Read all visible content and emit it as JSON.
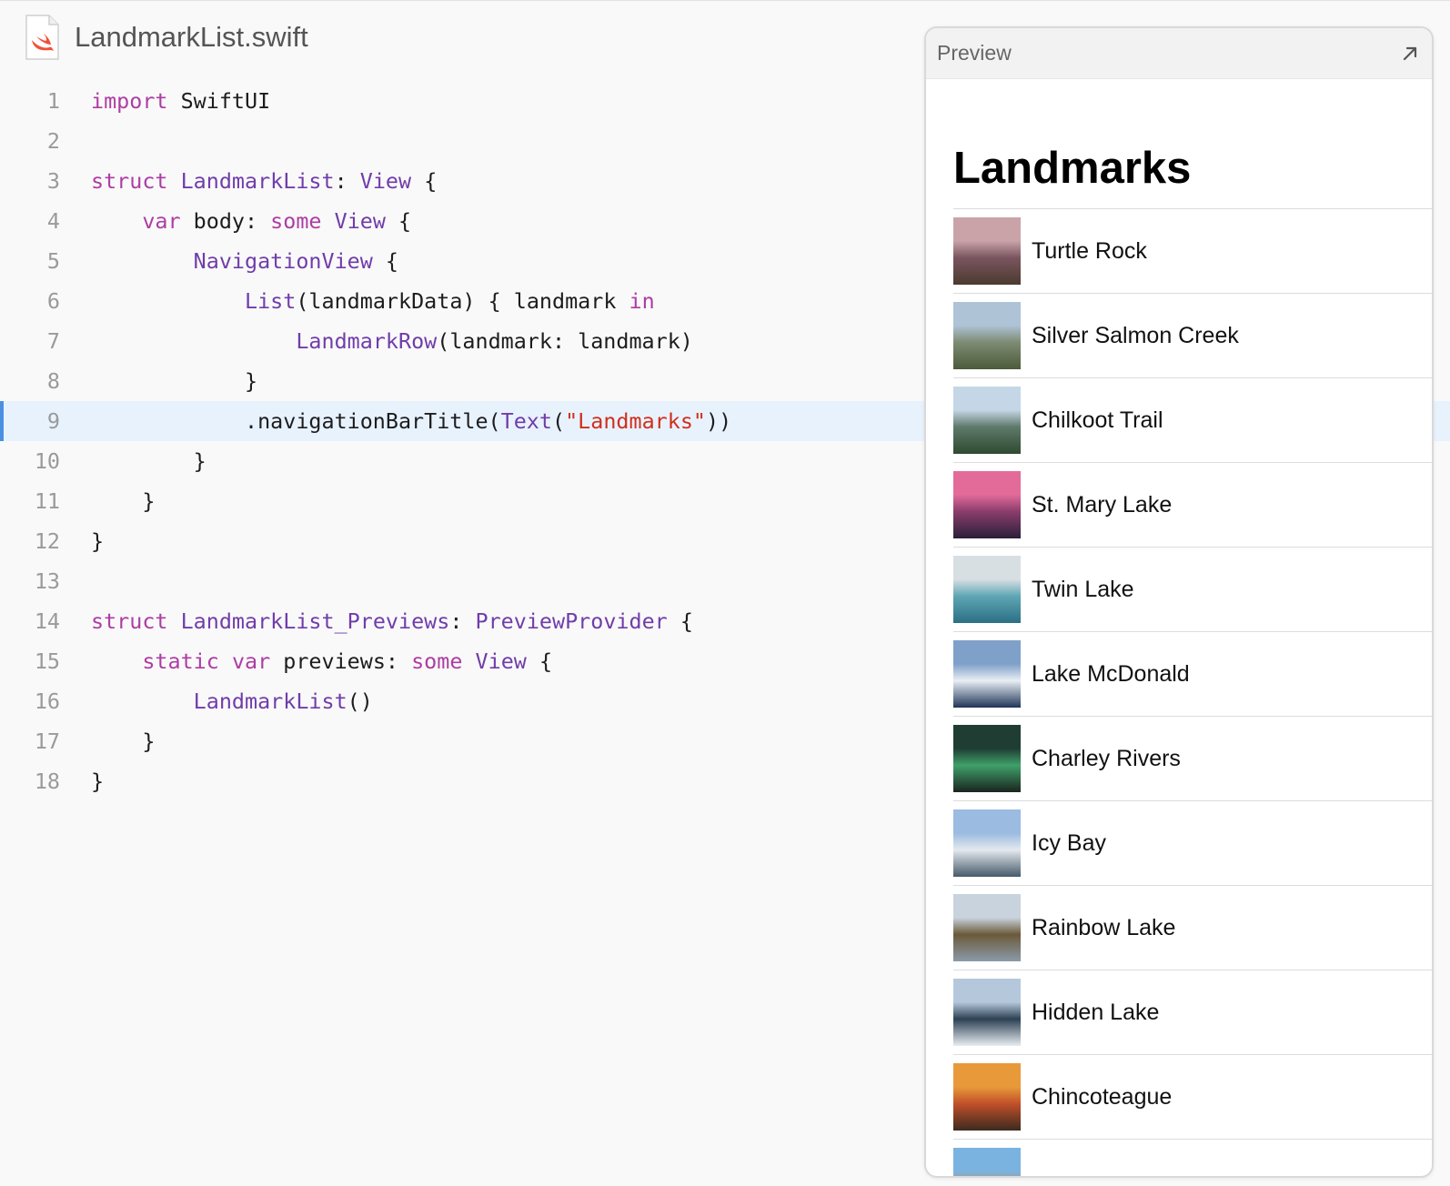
{
  "file": {
    "name": "LandmarkList.swift",
    "icon": "swift-file-icon"
  },
  "code_lines": [
    {
      "n": "1",
      "tokens": [
        [
          "kw",
          "import"
        ],
        [
          "pl",
          " SwiftUI"
        ]
      ]
    },
    {
      "n": "2",
      "tokens": []
    },
    {
      "n": "3",
      "tokens": [
        [
          "kw",
          "struct"
        ],
        [
          "pl",
          " "
        ],
        [
          "ty",
          "LandmarkList"
        ],
        [
          "pl",
          ": "
        ],
        [
          "ty",
          "View"
        ],
        [
          "pl",
          " {"
        ]
      ]
    },
    {
      "n": "4",
      "tokens": [
        [
          "pl",
          "    "
        ],
        [
          "kw",
          "var"
        ],
        [
          "pl",
          " body: "
        ],
        [
          "kw",
          "some"
        ],
        [
          "pl",
          " "
        ],
        [
          "ty",
          "View"
        ],
        [
          "pl",
          " {"
        ]
      ]
    },
    {
      "n": "5",
      "tokens": [
        [
          "pl",
          "        "
        ],
        [
          "ty",
          "NavigationView"
        ],
        [
          "pl",
          " {"
        ]
      ]
    },
    {
      "n": "6",
      "tokens": [
        [
          "pl",
          "            "
        ],
        [
          "ty",
          "List"
        ],
        [
          "pl",
          "(landmarkData) { landmark "
        ],
        [
          "kw",
          "in"
        ]
      ]
    },
    {
      "n": "7",
      "tokens": [
        [
          "pl",
          "                "
        ],
        [
          "ty",
          "LandmarkRow"
        ],
        [
          "pl",
          "(landmark: landmark)"
        ]
      ]
    },
    {
      "n": "8",
      "tokens": [
        [
          "pl",
          "            }"
        ]
      ]
    },
    {
      "n": "9",
      "highlight": true,
      "tokens": [
        [
          "pl",
          "            .navigationBarTitle("
        ],
        [
          "ty",
          "Text"
        ],
        [
          "pl",
          "("
        ],
        [
          "str",
          "\"Landmarks\""
        ],
        [
          "pl",
          "))"
        ]
      ]
    },
    {
      "n": "10",
      "tokens": [
        [
          "pl",
          "        }"
        ]
      ]
    },
    {
      "n": "11",
      "tokens": [
        [
          "pl",
          "    }"
        ]
      ]
    },
    {
      "n": "12",
      "tokens": [
        [
          "pl",
          "}"
        ]
      ]
    },
    {
      "n": "13",
      "tokens": []
    },
    {
      "n": "14",
      "tokens": [
        [
          "kw",
          "struct"
        ],
        [
          "pl",
          " "
        ],
        [
          "ty",
          "LandmarkList_Previews"
        ],
        [
          "pl",
          ": "
        ],
        [
          "ty",
          "PreviewProvider"
        ],
        [
          "pl",
          " {"
        ]
      ]
    },
    {
      "n": "15",
      "tokens": [
        [
          "pl",
          "    "
        ],
        [
          "kw",
          "static"
        ],
        [
          "pl",
          " "
        ],
        [
          "kw",
          "var"
        ],
        [
          "pl",
          " previews: "
        ],
        [
          "kw",
          "some"
        ],
        [
          "pl",
          " "
        ],
        [
          "ty",
          "View"
        ],
        [
          "pl",
          " {"
        ]
      ]
    },
    {
      "n": "16",
      "tokens": [
        [
          "pl",
          "        "
        ],
        [
          "ty",
          "LandmarkList"
        ],
        [
          "pl",
          "()"
        ]
      ]
    },
    {
      "n": "17",
      "tokens": [
        [
          "pl",
          "    }"
        ]
      ]
    },
    {
      "n": "18",
      "tokens": [
        [
          "pl",
          "}"
        ]
      ]
    }
  ],
  "preview": {
    "label": "Preview",
    "expand_icon": "expand-arrow-icon",
    "nav_title": "Landmarks",
    "rows": [
      {
        "name": "Turtle Rock",
        "colors": [
          "#c9a3a8",
          "#7a5560",
          "#4a3b2e"
        ]
      },
      {
        "name": "Silver Salmon Creek",
        "colors": [
          "#aec3d6",
          "#7d8b73",
          "#4b5b3a"
        ]
      },
      {
        "name": "Chilkoot Trail",
        "colors": [
          "#c5d6e6",
          "#5e7a6a",
          "#2f4a30"
        ]
      },
      {
        "name": "St. Mary Lake",
        "colors": [
          "#e26b9a",
          "#8a3d6b",
          "#2a1f3a"
        ]
      },
      {
        "name": "Twin Lake",
        "colors": [
          "#d8dfe3",
          "#5fa6b5",
          "#2b6f84"
        ]
      },
      {
        "name": "Lake McDonald",
        "colors": [
          "#7fa0c8",
          "#e8eef4",
          "#1f3558"
        ]
      },
      {
        "name": "Charley Rivers",
        "colors": [
          "#1f3d33",
          "#3fa06a",
          "#1a241f"
        ]
      },
      {
        "name": "Icy Bay",
        "colors": [
          "#9bbbe0",
          "#e4e9ee",
          "#455a6a"
        ]
      },
      {
        "name": "Rainbow Lake",
        "colors": [
          "#c9d3dd",
          "#6b5a3a",
          "#8a9aa8"
        ]
      },
      {
        "name": "Hidden Lake",
        "colors": [
          "#b5c8db",
          "#2d4154",
          "#e8edf1"
        ]
      },
      {
        "name": "Chincoteague",
        "colors": [
          "#e89a3a",
          "#c2502a",
          "#3b2a1e"
        ]
      },
      {
        "name": "",
        "colors": [
          "#7ab3e0",
          "#c08a5a",
          "#6a4a2a"
        ]
      }
    ]
  }
}
